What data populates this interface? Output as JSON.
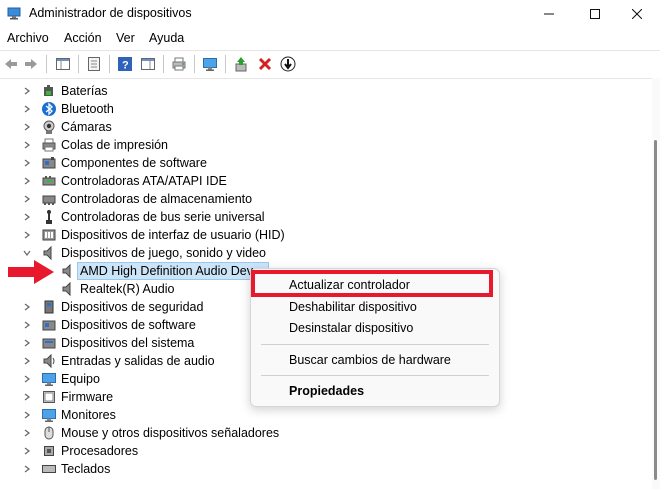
{
  "window": {
    "title": "Administrador de dispositivos"
  },
  "menu": {
    "items": [
      "Archivo",
      "Acción",
      "Ver",
      "Ayuda"
    ]
  },
  "tree": {
    "categories": [
      {
        "label": "Baterías",
        "icon": "battery-icon"
      },
      {
        "label": "Bluetooth",
        "icon": "bluetooth-icon"
      },
      {
        "label": "Cámaras",
        "icon": "camera-icon"
      },
      {
        "label": "Colas de impresión",
        "icon": "printer-icon"
      },
      {
        "label": "Componentes de software",
        "icon": "software-component-icon"
      },
      {
        "label": "Controladoras ATA/ATAPI IDE",
        "icon": "ide-controller-icon"
      },
      {
        "label": "Controladoras de almacenamiento",
        "icon": "storage-controller-icon"
      },
      {
        "label": "Controladoras de bus serie universal",
        "icon": "usb-icon"
      },
      {
        "label": "Dispositivos de interfaz de usuario (HID)",
        "icon": "hid-icon"
      },
      {
        "label": "Dispositivos de juego, sonido y video",
        "icon": "speaker-icon"
      },
      {
        "label": "AMD High Definition Audio Dev",
        "icon": "speaker-icon"
      },
      {
        "label": "Realtek(R) Audio",
        "icon": "speaker-icon"
      },
      {
        "label": "Dispositivos de seguridad",
        "icon": "security-device-icon"
      },
      {
        "label": "Dispositivos de software",
        "icon": "software-device-icon"
      },
      {
        "label": "Dispositivos del sistema",
        "icon": "system-device-icon"
      },
      {
        "label": "Entradas y salidas de audio",
        "icon": "audio-io-icon"
      },
      {
        "label": "Equipo",
        "icon": "computer-icon"
      },
      {
        "label": "Firmware",
        "icon": "firmware-icon"
      },
      {
        "label": "Monitores",
        "icon": "monitor-icon"
      },
      {
        "label": "Mouse y otros dispositivos señaladores",
        "icon": "mouse-icon"
      },
      {
        "label": "Procesadores",
        "icon": "processor-icon"
      },
      {
        "label": "Teclados",
        "icon": "keyboard-icon"
      }
    ]
  },
  "context_menu": {
    "update_driver": "Actualizar controlador",
    "disable_device": "Deshabilitar dispositivo",
    "uninstall_device": "Desinstalar dispositivo",
    "scan_hardware": "Buscar cambios de hardware",
    "properties": "Propiedades"
  },
  "colors": {
    "annotation_red": "#e8192c",
    "selection": "#cce4f7"
  }
}
